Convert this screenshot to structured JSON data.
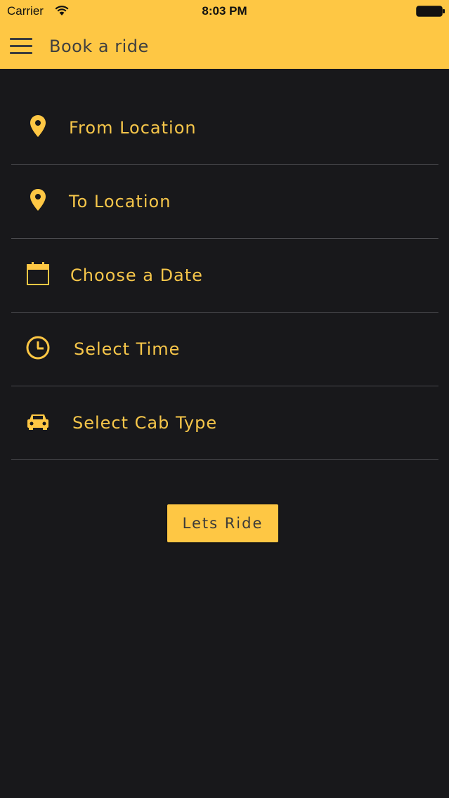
{
  "status_bar": {
    "carrier": "Carrier",
    "time": "8:03 PM",
    "icons": [
      "wifi-icon",
      "battery-icon"
    ]
  },
  "header": {
    "menu_icon": "hamburger-menu-icon",
    "title": "Book a ride"
  },
  "form": {
    "items": [
      {
        "label": "From Location",
        "icon": "location-pin-icon"
      },
      {
        "label": "To Location",
        "icon": "location-pin-icon"
      },
      {
        "label": "Choose a Date",
        "icon": "calendar-icon"
      },
      {
        "label": "Select Time",
        "icon": "clock-icon"
      },
      {
        "label": "Select Cab Type",
        "icon": "car-icon"
      }
    ]
  },
  "action": {
    "button_label": "Lets Ride"
  },
  "colors": {
    "accent": "#fec744",
    "background": "#18181b",
    "label_text": "#f6c64a",
    "divider": "#4a4a4e"
  }
}
